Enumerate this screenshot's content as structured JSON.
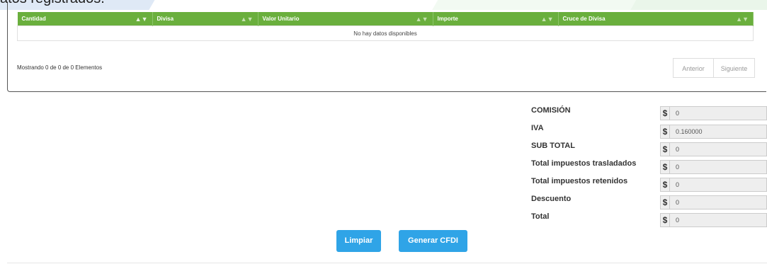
{
  "banner": {
    "text": "atos registrados."
  },
  "table": {
    "columns": [
      {
        "label": "Cantidad",
        "sort": "▲▼"
      },
      {
        "label": "Divisa",
        "sort": "▲▼"
      },
      {
        "label": "Valor Unitario",
        "sort": "▲▼"
      },
      {
        "label": "Importe",
        "sort": "▲▼"
      },
      {
        "label": "Cruce de Divisa",
        "sort": "▲▼"
      }
    ],
    "empty_message": "No hay datos disponibles",
    "info": "Mostrando 0 de 0 de 0 Elementos",
    "pager": {
      "prev": "Anterior",
      "next": "Siguiente"
    }
  },
  "totals": [
    {
      "label": "COMISIÓN",
      "currency": "$",
      "value": "0"
    },
    {
      "label": "IVA",
      "currency": "$",
      "value": "0.160000"
    },
    {
      "label": "SUB TOTAL",
      "currency": "$",
      "value": "0"
    },
    {
      "label": "Total impuestos trasladados",
      "currency": "$",
      "value": "0"
    },
    {
      "label": "Total impuestos retenidos",
      "currency": "$",
      "value": "0"
    },
    {
      "label": "Descuento",
      "currency": "$",
      "value": "0"
    },
    {
      "label": "Total",
      "currency": "$",
      "value": "0"
    }
  ],
  "actions": {
    "clear": "Limpiar",
    "generate": "Generar CFDI"
  },
  "colors": {
    "header_green": "#6aaf3d",
    "button_blue": "#2fa4e7"
  }
}
